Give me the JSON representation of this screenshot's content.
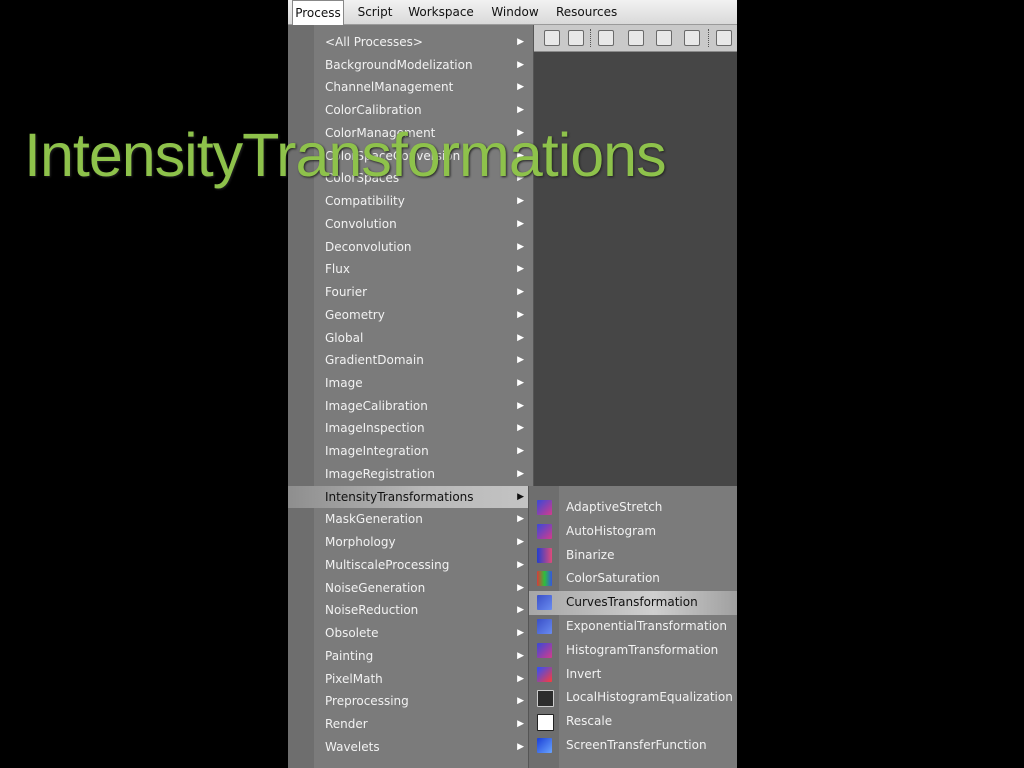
{
  "overlay_title": "IntensityTransformations",
  "menubar": {
    "items": [
      "Process",
      "Script",
      "Workspace",
      "Window",
      "Resources"
    ]
  },
  "process_menu": {
    "items": [
      "<All Processes>",
      "BackgroundModelization",
      "ChannelManagement",
      "ColorCalibration",
      "ColorManagement",
      "ColorSpaceConversion",
      "ColorSpaces",
      "Compatibility",
      "Convolution",
      "Deconvolution",
      "Flux",
      "Fourier",
      "Geometry",
      "Global",
      "GradientDomain",
      "Image",
      "ImageCalibration",
      "ImageInspection",
      "ImageIntegration",
      "ImageRegistration",
      "IntensityTransformations",
      "MaskGeneration",
      "Morphology",
      "MultiscaleProcessing",
      "NoiseGeneration",
      "NoiseReduction",
      "Obsolete",
      "Painting",
      "PixelMath",
      "Preprocessing",
      "Render",
      "Wavelets"
    ],
    "highlighted_index": 20
  },
  "submenu": {
    "items": [
      {
        "label": "AdaptiveStretch",
        "icon": "adaptive-stretch-icon"
      },
      {
        "label": "AutoHistogram",
        "icon": "auto-histogram-icon"
      },
      {
        "label": "Binarize",
        "icon": "binarize-icon"
      },
      {
        "label": "ColorSaturation",
        "icon": "color-saturation-icon"
      },
      {
        "label": "CurvesTransformation",
        "icon": "curves-transformation-icon"
      },
      {
        "label": "ExponentialTransformation",
        "icon": "exponential-transformation-icon"
      },
      {
        "label": "HistogramTransformation",
        "icon": "histogram-transformation-icon"
      },
      {
        "label": "Invert",
        "icon": "invert-icon"
      },
      {
        "label": "LocalHistogramEqualization",
        "icon": "local-histogram-equalization-icon"
      },
      {
        "label": "Rescale",
        "icon": "rescale-icon"
      },
      {
        "label": "ScreenTransferFunction",
        "icon": "screen-transfer-function-icon"
      }
    ],
    "highlighted_index": 4
  },
  "colors": {
    "title": "#8ec24b",
    "menu_bg": "#7b7b7b",
    "highlight": "#c4c4c4"
  }
}
